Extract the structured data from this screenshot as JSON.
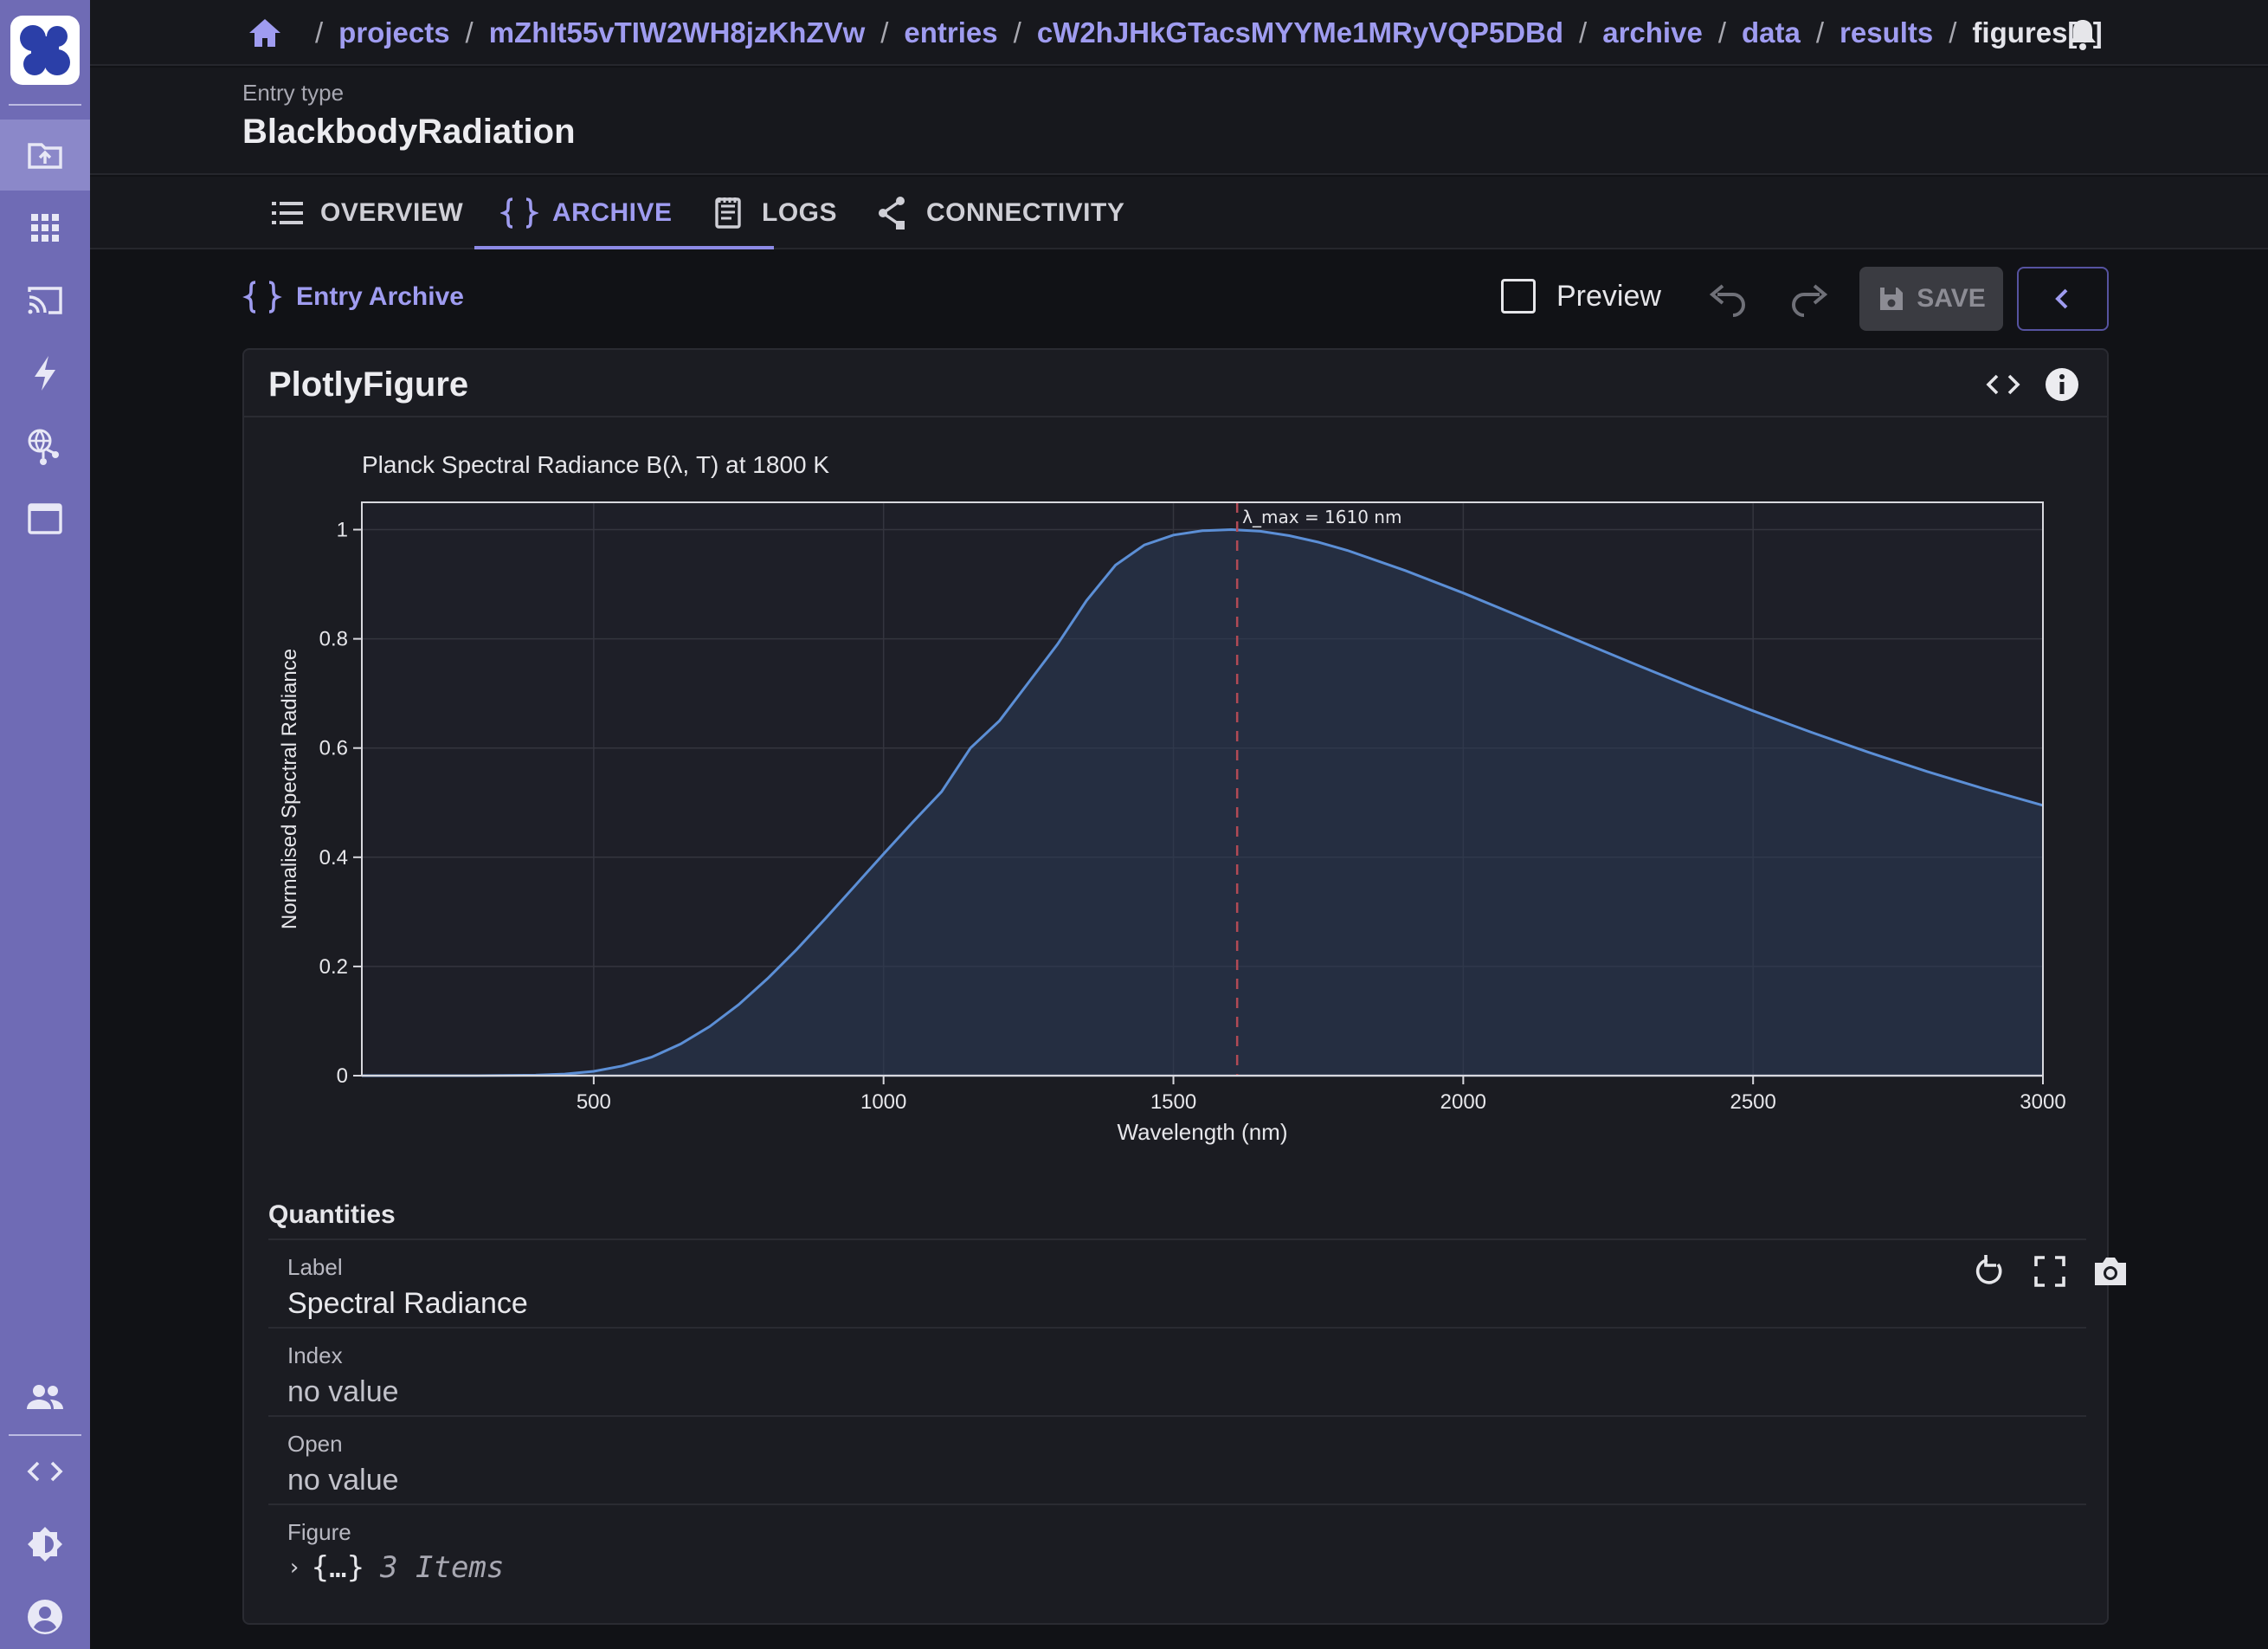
{
  "breadcrumb": {
    "items": [
      "projects",
      "mZhIt55vTIW2WH8jzKhZVw",
      "entries",
      "cW2hJHkGTacsMYYMe1MRyVQP5DBd",
      "archive",
      "data",
      "results"
    ],
    "current": "figures[0]"
  },
  "header": {
    "entry_type_label": "Entry type",
    "entry_type_value": "BlackbodyRadiation"
  },
  "tabs": [
    {
      "label": "OVERVIEW",
      "icon": "list-icon"
    },
    {
      "label": "ARCHIVE",
      "icon": "braces-icon",
      "active": true
    },
    {
      "label": "LOGS",
      "icon": "logs-icon"
    },
    {
      "label": "CONNECTIVITY",
      "icon": "share-icon"
    }
  ],
  "toolbar": {
    "archive_title": "Entry Archive",
    "preview_label": "Preview",
    "save_label": "SAVE"
  },
  "card": {
    "title": "PlotlyFigure"
  },
  "quantities": {
    "heading": "Quantities",
    "rows": [
      {
        "label": "Label",
        "value": "Spectral Radiance"
      },
      {
        "label": "Index",
        "value": "no value"
      },
      {
        "label": "Open",
        "value": "no value"
      }
    ],
    "figure": {
      "label": "Figure",
      "value": "{…}",
      "count": "3 Items"
    }
  },
  "colors": {
    "accent": "#9f9cf0",
    "rail": "#6f6bb5",
    "line": "#5c8fd6",
    "vline": "#b24a55"
  },
  "chart_data": {
    "type": "area",
    "title": "Planck Spectral Radiance B(λ, T) at 1800 K",
    "xlabel": "Wavelength (nm)",
    "ylabel": "Normalised Spectral Radiance",
    "xlim": [
      100,
      3000
    ],
    "ylim": [
      0,
      1.05
    ],
    "xticks": [
      500,
      1000,
      1500,
      2000,
      2500,
      3000
    ],
    "yticks": [
      0,
      0.2,
      0.4,
      0.6,
      0.8,
      1
    ],
    "ytick_labels": [
      "0",
      "0.2",
      "0.4",
      "0.6",
      "0.8",
      "1"
    ],
    "annotation": {
      "x": 1610,
      "text": "λ_max = 1610 nm"
    },
    "grid": true,
    "series": [
      {
        "x": [
          100,
          200,
          300,
          400,
          450,
          500,
          550,
          600,
          650,
          700,
          750,
          800,
          850,
          900,
          950,
          1000,
          1050,
          1100,
          1150,
          1200,
          1250,
          1300,
          1350,
          1400,
          1450,
          1500,
          1550,
          1600,
          1650,
          1700,
          1750,
          1800,
          1900,
          2000,
          2100,
          2200,
          2300,
          2400,
          2500,
          2600,
          2700,
          2800,
          2900,
          3000
        ],
        "y": [
          0,
          0,
          0,
          0.001,
          0.003,
          0.008,
          0.018,
          0.034,
          0.058,
          0.09,
          0.13,
          0.178,
          0.231,
          0.288,
          0.347,
          0.406,
          0.464,
          0.52,
          0.6,
          0.65,
          0.72,
          0.79,
          0.87,
          0.935,
          0.972,
          0.99,
          0.998,
          1.0,
          0.997,
          0.989,
          0.977,
          0.962,
          0.925,
          0.884,
          0.84,
          0.796,
          0.752,
          0.709,
          0.668,
          0.629,
          0.592,
          0.557,
          0.525,
          0.495
        ]
      }
    ]
  }
}
